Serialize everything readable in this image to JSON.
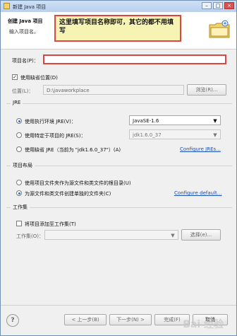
{
  "window": {
    "title": "新建 Java 项目",
    "buttons": {
      "minimize": "–",
      "maximize": "□",
      "close": "×"
    }
  },
  "header": {
    "title": "创建 Java 项目",
    "subtitle": "输入项目名。"
  },
  "callout": {
    "text": "这里填写项目名称即可，其它的都不用填写"
  },
  "project": {
    "name_label": "项目名(P)：",
    "name_value": "",
    "use_default_location_label": "使用缺省位置(D)",
    "use_default_location_checked": true,
    "location_label": "位置(L)：",
    "location_value": "D:\\javaworkplace",
    "browse_label": "浏览(R)..."
  },
  "jre": {
    "group_title": "JRE",
    "options": [
      {
        "label": "使用执行环境 JRE(V)：",
        "selected": true
      },
      {
        "label": "使用特定于项目的 JRE(S)：",
        "selected": false
      },
      {
        "label": "使用缺省 JRE（当前为 \"jdk1.6.0_37\"）(A)",
        "selected": false
      }
    ],
    "exec_env_select": "JavaSE-1.6",
    "project_specific_select": "jdk1.6.0_37",
    "configure_link": "Configure JREs..."
  },
  "layout": {
    "group_title": "项目布局",
    "options": [
      {
        "label": "使用项目文件夹作为源文件和类文件的根目录(U)",
        "selected": false
      },
      {
        "label": "为源文件和类文件创建单独的文件夹(C)",
        "selected": true
      }
    ],
    "configure_link": "Configure default..."
  },
  "working_sets": {
    "group_title": "工作集",
    "add_label": "将项目添加至工作集(T)",
    "add_checked": false,
    "label": "工作集(O)：",
    "select_value": "",
    "select_button": "选择(e)..."
  },
  "footer": {
    "help_icon": "?",
    "back": "< 上一步(B)",
    "next": "下一步(N) >",
    "finish": "完成(F)",
    "cancel": "取消"
  },
  "watermark": {
    "text": "Bai 经验"
  }
}
